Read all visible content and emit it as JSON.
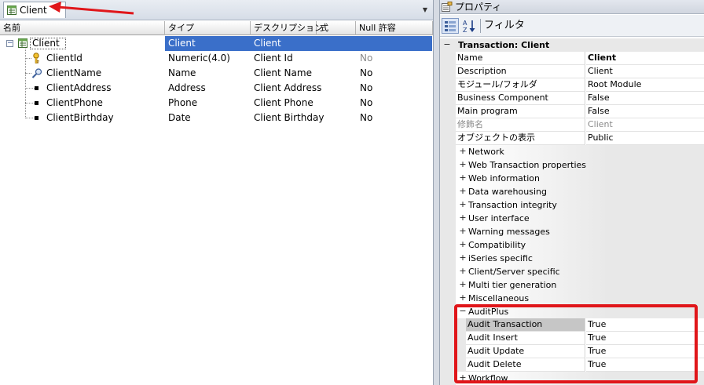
{
  "editor": {
    "tab_label": "Client",
    "dropdown_glyph": "▼",
    "columns": [
      "名前",
      "タイプ",
      "デスクリプション",
      "式",
      "Null 許容"
    ],
    "rows": [
      {
        "name": "Client",
        "type": "Client",
        "description": "Client",
        "formula": "",
        "nullable": "",
        "icon": "transaction-icon",
        "selected": true
      },
      {
        "name": "ClientId",
        "type": "Numeric(4.0)",
        "description": "Client Id",
        "formula": "",
        "nullable": "No",
        "icon": "key-icon",
        "nullable_grey": true
      },
      {
        "name": "ClientName",
        "type": "Name",
        "description": "Client Name",
        "formula": "",
        "nullable": "No",
        "icon": "search-key-icon"
      },
      {
        "name": "ClientAddress",
        "type": "Address",
        "description": "Client Address",
        "formula": "",
        "nullable": "No",
        "icon": "bullet-icon"
      },
      {
        "name": "ClientPhone",
        "type": "Phone",
        "description": "Client Phone",
        "formula": "",
        "nullable": "No",
        "icon": "bullet-icon"
      },
      {
        "name": "ClientBirthday",
        "type": "Date",
        "description": "Client Birthday",
        "formula": "",
        "nullable": "No",
        "icon": "bullet-icon"
      }
    ]
  },
  "properties": {
    "title": "プロパティ",
    "toolbar": {
      "filter_label": "フィルタ"
    },
    "section_title": "Transaction: Client",
    "expand_minus": "−",
    "expand_plus": "+",
    "items": [
      {
        "name": "Name",
        "value": "Client",
        "bold": true
      },
      {
        "name": "Description",
        "value": "Client"
      },
      {
        "name": "モジュール/フォルダ",
        "value": "Root Module"
      },
      {
        "name": "Business Component",
        "value": "False"
      },
      {
        "name": "Main program",
        "value": "False"
      },
      {
        "name": "修飾名",
        "value": "Client",
        "grey": true
      },
      {
        "name": "オブジェクトの表示",
        "value": "Public"
      }
    ],
    "categories": [
      "Network",
      "Web Transaction properties",
      "Web information",
      "Data warehousing",
      "Transaction integrity",
      "User interface",
      "Warning messages",
      "Compatibility",
      "iSeries specific",
      "Client/Server specific",
      "Multi tier generation",
      "Miscellaneous"
    ],
    "auditplus": {
      "label": "AuditPlus",
      "items": [
        {
          "name": "Audit Transaction",
          "value": "True"
        },
        {
          "name": "Audit Insert",
          "value": "True"
        },
        {
          "name": "Audit Update",
          "value": "True"
        },
        {
          "name": "Audit Delete",
          "value": "True"
        }
      ]
    },
    "last_category": "Workflow"
  },
  "colors": {
    "annotation_red": "#e0161a",
    "selection_blue": "#3a6fc9"
  }
}
